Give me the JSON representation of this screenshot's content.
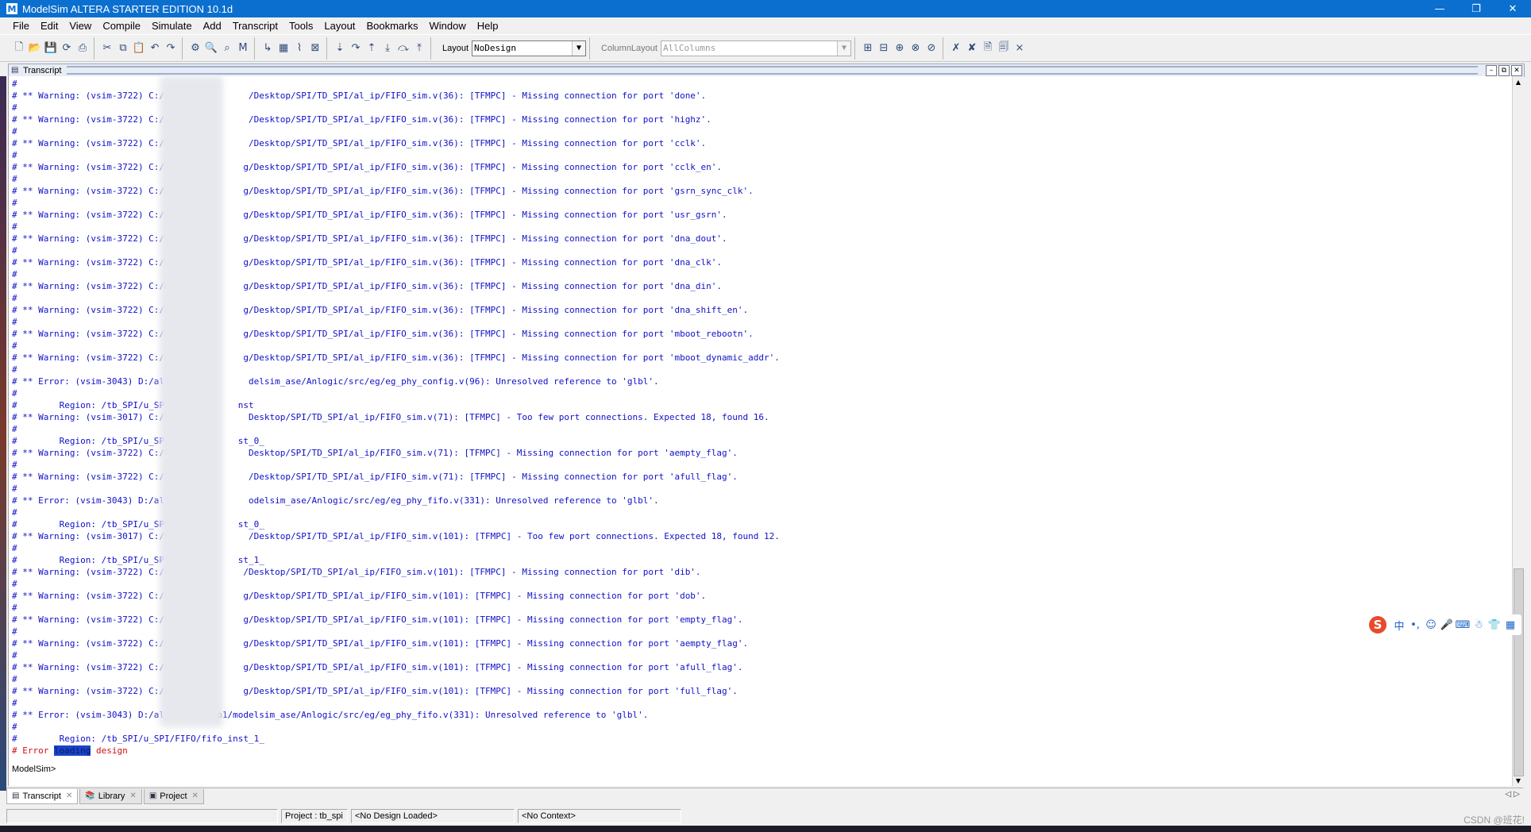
{
  "window": {
    "title": "ModelSim ALTERA STARTER EDITION 10.1d",
    "app_icon": "M",
    "controls": [
      "—",
      "❐",
      "✕"
    ]
  },
  "menu": [
    "File",
    "Edit",
    "View",
    "Compile",
    "Simulate",
    "Add",
    "Transcript",
    "Tools",
    "Layout",
    "Bookmarks",
    "Window",
    "Help"
  ],
  "toolbar": {
    "layout_label": "Layout",
    "layout_value": "NoDesign",
    "column_layout_label": "ColumnLayout",
    "column_layout_value": "AllColumns"
  },
  "panel": {
    "title": "Transcript"
  },
  "transcript": [
    {
      "t": "#",
      "k": "hash"
    },
    {
      "t": "# ** Warning: (vsim-3722) C:/Users/          /Desktop/SPI/TD_SPI/al_ip/FIFO_sim.v(36): [TFMPC] - Missing connection for port 'done'.",
      "k": "warn"
    },
    {
      "t": "#",
      "k": "hash"
    },
    {
      "t": "# ** Warning: (vsim-3722) C:/Users/          /Desktop/SPI/TD_SPI/al_ip/FIFO_sim.v(36): [TFMPC] - Missing connection for port 'highz'.",
      "k": "warn"
    },
    {
      "t": "#",
      "k": "hash"
    },
    {
      "t": "# ** Warning: (vsim-3722) C:/Users/h         /Desktop/SPI/TD_SPI/al_ip/FIFO_sim.v(36): [TFMPC] - Missing connection for port 'cclk'.",
      "k": "warn"
    },
    {
      "t": "#",
      "k": "hash"
    },
    {
      "t": "# ** Warning: (vsim-3722) C:/Users          g/Desktop/SPI/TD_SPI/al_ip/FIFO_sim.v(36): [TFMPC] - Missing connection for port 'cclk_en'.",
      "k": "warn"
    },
    {
      "t": "#",
      "k": "hash"
    },
    {
      "t": "# ** Warning: (vsim-3722) C:/Users          g/Desktop/SPI/TD_SPI/al_ip/FIFO_sim.v(36): [TFMPC] - Missing connection for port 'gsrn_sync_clk'.",
      "k": "warn"
    },
    {
      "t": "#",
      "k": "hash"
    },
    {
      "t": "# ** Warning: (vsim-3722) C:/User           g/Desktop/SPI/TD_SPI/al_ip/FIFO_sim.v(36): [TFMPC] - Missing connection for port 'usr_gsrn'.",
      "k": "warn"
    },
    {
      "t": "#",
      "k": "hash"
    },
    {
      "t": "# ** Warning: (vsim-3722) C:/User           g/Desktop/SPI/TD_SPI/al_ip/FIFO_sim.v(36): [TFMPC] - Missing connection for port 'dna_dout'.",
      "k": "warn"
    },
    {
      "t": "#",
      "k": "hash"
    },
    {
      "t": "# ** Warning: (vsim-3722) C:/Use            g/Desktop/SPI/TD_SPI/al_ip/FIFO_sim.v(36): [TFMPC] - Missing connection for port 'dna_clk'.",
      "k": "warn"
    },
    {
      "t": "#",
      "k": "hash"
    },
    {
      "t": "# ** Warning: (vsim-3722) C:/Use            g/Desktop/SPI/TD_SPI/al_ip/FIFO_sim.v(36): [TFMPC] - Missing connection for port 'dna_din'.",
      "k": "warn"
    },
    {
      "t": "#",
      "k": "hash"
    },
    {
      "t": "# ** Warning: (vsim-3722) C:/Use            g/Desktop/SPI/TD_SPI/al_ip/FIFO_sim.v(36): [TFMPC] - Missing connection for port 'dna_shift_en'.",
      "k": "warn"
    },
    {
      "t": "#",
      "k": "hash"
    },
    {
      "t": "# ** Warning: (vsim-3722) C:/User           g/Desktop/SPI/TD_SPI/al_ip/FIFO_sim.v(36): [TFMPC] - Missing connection for port 'mboot_rebootn'.",
      "k": "warn"
    },
    {
      "t": "#",
      "k": "hash"
    },
    {
      "t": "# ** Warning: (vsim-3722) C:/Users          g/Desktop/SPI/TD_SPI/al_ip/FIFO_sim.v(36): [TFMPC] - Missing connection for port 'mboot_dynamic_addr'.",
      "k": "warn"
    },
    {
      "t": "#",
      "k": "hash"
    },
    {
      "t": "# ** Error: (vsim-3043) D:/altera/1          delsim_ase/Anlogic/src/eg/eg_phy_config.v(96): Unresolved reference to 'glbl'.",
      "k": "warn"
    },
    {
      "t": "#",
      "k": "hash"
    },
    {
      "t": "#        Region: /tb_SPI/u_SPI/FIF         nst",
      "k": "warn"
    },
    {
      "t": "# ** Warning: (vsim-3017) C:/Users/          Desktop/SPI/TD_SPI/al_ip/FIFO_sim.v(71): [TFMPC] - Too few port connections. Expected 18, found 16.",
      "k": "warn"
    },
    {
      "t": "#",
      "k": "hash"
    },
    {
      "t": "#        Region: /tb_SPI/u_SPI/FIF         st_0_",
      "k": "warn"
    },
    {
      "t": "# ** Warning: (vsim-3722) C:/Users/          Desktop/SPI/TD_SPI/al_ip/FIFO_sim.v(71): [TFMPC] - Missing connection for port 'aempty_flag'.",
      "k": "warn"
    },
    {
      "t": "#",
      "k": "hash"
    },
    {
      "t": "# ** Warning: (vsim-3722) C:/Users/          /Desktop/SPI/TD_SPI/al_ip/FIFO_sim.v(71): [TFMPC] - Missing connection for port 'afull_flag'.",
      "k": "warn"
    },
    {
      "t": "#",
      "k": "hash"
    },
    {
      "t": "# ** Error: (vsim-3043) D:/altera/1          odelsim_ase/Anlogic/src/eg/eg_phy_fifo.v(331): Unresolved reference to 'glbl'.",
      "k": "warn"
    },
    {
      "t": "#",
      "k": "hash"
    },
    {
      "t": "#        Region: /tb_SPI/u_SPI/FIF         st_0_",
      "k": "warn"
    },
    {
      "t": "# ** Warning: (vsim-3017) C:/Users/          /Desktop/SPI/TD_SPI/al_ip/FIFO_sim.v(101): [TFMPC] - Too few port connections. Expected 18, found 12.",
      "k": "warn"
    },
    {
      "t": "#",
      "k": "hash"
    },
    {
      "t": "#        Region: /tb_SPI/u_SPI/FIFO        st_1_",
      "k": "warn"
    },
    {
      "t": "# ** Warning: (vsim-3722) C:/Users/h        /Desktop/SPI/TD_SPI/al_ip/FIFO_sim.v(101): [TFMPC] - Missing connection for port 'dib'.",
      "k": "warn"
    },
    {
      "t": "#",
      "k": "hash"
    },
    {
      "t": "# ** Warning: (vsim-3722) C:/Users/h        g/Desktop/SPI/TD_SPI/al_ip/FIFO_sim.v(101): [TFMPC] - Missing connection for port 'dob'.",
      "k": "warn"
    },
    {
      "t": "#",
      "k": "hash"
    },
    {
      "t": "# ** Warning: (vsim-3722) C:/Users/h        g/Desktop/SPI/TD_SPI/al_ip/FIFO_sim.v(101): [TFMPC] - Missing connection for port 'empty_flag'.",
      "k": "warn"
    },
    {
      "t": "#",
      "k": "hash"
    },
    {
      "t": "# ** Warning: (vsim-3722) C:/Users/         g/Desktop/SPI/TD_SPI/al_ip/FIFO_sim.v(101): [TFMPC] - Missing connection for port 'aempty_flag'.",
      "k": "warn"
    },
    {
      "t": "#",
      "k": "hash"
    },
    {
      "t": "# ** Warning: (vsim-3722) C:/Users          g/Desktop/SPI/TD_SPI/al_ip/FIFO_sim.v(101): [TFMPC] - Missing connection for port 'afull_flag'.",
      "k": "warn"
    },
    {
      "t": "#",
      "k": "hash"
    },
    {
      "t": "# ** Warning: (vsim-3722) C:/Users/         g/Desktop/SPI/TD_SPI/al_ip/FIFO_sim.v(101): [TFMPC] - Missing connection for port 'full_flag'.",
      "k": "warn"
    },
    {
      "t": "#",
      "k": "hash"
    },
    {
      "t": "# ** Error: (vsim-3043) D:/altera/13.0sp1/modelsim_ase/Anlogic/src/eg/eg_phy_fifo.v(331): Unresolved reference to 'glbl'.",
      "k": "warn"
    },
    {
      "t": "#",
      "k": "hash"
    },
    {
      "t": "#        Region: /tb_SPI/u_SPI/FIFO/fifo_inst_1_",
      "k": "warn"
    }
  ],
  "error_line": {
    "prefix": "# Error ",
    "selected": "loading",
    "suffix": " design"
  },
  "prompt": "ModelSim>",
  "tabs": [
    {
      "label": "Transcript",
      "icon": "transcript-icon"
    },
    {
      "label": "Library",
      "icon": "library-icon"
    },
    {
      "label": "Project",
      "icon": "project-icon"
    }
  ],
  "status": {
    "project": "Project : tb_spi",
    "design": "<No Design Loaded>",
    "context": "<No Context>"
  },
  "watermark": "CSDN @班花!",
  "ime": {
    "lang": "中",
    "punct": "•,"
  }
}
